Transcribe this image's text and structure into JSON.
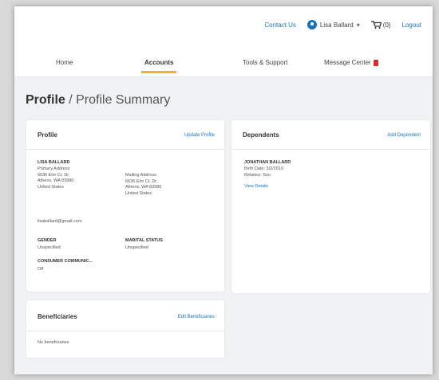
{
  "topbar": {
    "contact_label": "Contact Us",
    "user_name": "Lisa Ballard",
    "cart_count": "(0)",
    "logout_label": "Logout"
  },
  "nav": {
    "tabs": [
      {
        "label": "Home",
        "active": false
      },
      {
        "label": "Accounts",
        "active": true
      },
      {
        "label": "Tools & Support",
        "active": false
      },
      {
        "label": "Message Center",
        "active": false
      }
    ]
  },
  "page": {
    "title_main": "Profile",
    "title_rest": " / Profile Summary"
  },
  "profile": {
    "title": "Profile",
    "edit_label": "Update Profile",
    "name": "LISA BALLARD",
    "home_address": [
      "Primary Address",
      "6636 Elm Ct. Dr.",
      "Athens, WA 83980",
      "United States"
    ],
    "mailing_address": [
      "Mailing Address",
      "6636 Elm Ct. Dr.",
      "Athens, WA 83980",
      "United States"
    ],
    "email": "lisaballard@gmail.com",
    "gender_label": "GENDER",
    "gender_value": "Unspecified",
    "marital_label": "MARITAL STATUS",
    "marital_value": "Unspecified",
    "consumer_label": "CONSUMER COMMUNIC...",
    "consumer_value": "Off"
  },
  "dependents": {
    "title": "Dependents",
    "add_label": "Add Dependent",
    "name": "JONATHAN BALLARD",
    "birth": "Birth Date: 3/2/2010",
    "relation": "Relation: Son",
    "details_label": "View Details"
  },
  "beneficiaries": {
    "title": "Beneficiaries",
    "add_label": "Edit Beneficiaries",
    "empty": "No beneficiaries"
  },
  "colors": {
    "accent": "#1a73b8",
    "tab_underline": "#f0b323",
    "badge": "#d62d2d",
    "page_bg": "#f1f2f3"
  }
}
